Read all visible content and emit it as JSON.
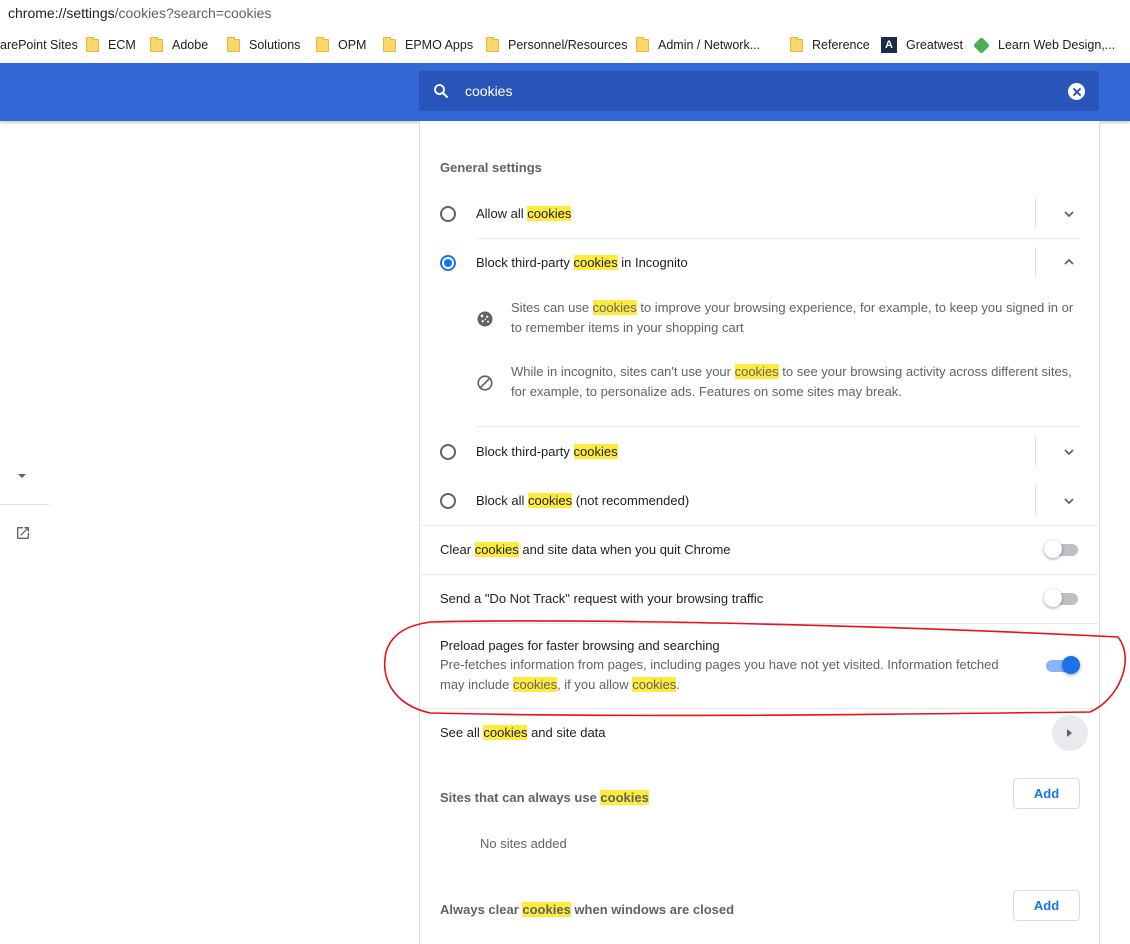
{
  "address_bar": {
    "host": "chrome://settings",
    "path": "/cookies?search=cookies"
  },
  "bookmarks": [
    {
      "label": "arePoint Sites",
      "icon": "none"
    },
    {
      "label": "ECM",
      "icon": "folder-icon"
    },
    {
      "label": "Adobe",
      "icon": "folder-icon"
    },
    {
      "label": "Solutions",
      "icon": "folder-icon"
    },
    {
      "label": "OPM",
      "icon": "folder-icon"
    },
    {
      "label": "EPMO Apps",
      "icon": "folder-icon"
    },
    {
      "label": "Personnel/Resources",
      "icon": "folder-icon"
    },
    {
      "label": "Admin / Network...",
      "icon": "folder-icon"
    },
    {
      "label": "Reference",
      "icon": "folder-icon"
    },
    {
      "label": "Greatwest",
      "icon": "greatwest-logo-icon"
    },
    {
      "label": "Learn Web Design,...",
      "icon": "learn-web-design-logo-icon"
    }
  ],
  "search": {
    "query": "cookies"
  },
  "highlight_word": "cookies",
  "general": {
    "title": "General settings",
    "allow_all": {
      "prefix": "Allow all ",
      "hl": "cookies",
      "suffix": ""
    },
    "block_incognito": {
      "prefix": "Block third-party ",
      "hl": "cookies",
      "suffix": " in Incognito",
      "detail1": {
        "prefix": "Sites can use ",
        "hl": "cookies",
        "suffix": " to improve your browsing experience, for example, to keep you signed in or to remember items in your shopping cart"
      },
      "detail2": {
        "prefix": "While in incognito, sites can't use your ",
        "hl": "cookies",
        "suffix": " to see your browsing activity across different sites, for example, to personalize ads. Features on some sites may break."
      }
    },
    "block_third_party": {
      "prefix": "Block third-party ",
      "hl": "cookies",
      "suffix": ""
    },
    "block_all": {
      "prefix": "Block all ",
      "hl": "cookies",
      "suffix": " (not recommended)"
    },
    "selected": "block_incognito"
  },
  "clear_on_quit": {
    "prefix": "Clear ",
    "hl": "cookies",
    "suffix": " and site data when you quit Chrome",
    "enabled": false
  },
  "do_not_track": {
    "label": "Send a \"Do Not Track\" request with your browsing traffic",
    "enabled": false
  },
  "preload": {
    "title": "Preload pages for faster browsing and searching",
    "desc_prefix": "Pre-fetches information from pages, including pages you have not yet visited. Information fetched may include ",
    "desc_hl1": "cookies",
    "desc_mid": ", if you allow ",
    "desc_hl2": "cookies",
    "desc_suffix": ".",
    "enabled": true
  },
  "see_all": {
    "prefix": "See all ",
    "hl": "cookies",
    "suffix": " and site data"
  },
  "always_use": {
    "prefix": "Sites that can always use ",
    "hl": "cookies",
    "add_label": "Add",
    "empty": "No sites added"
  },
  "always_clear": {
    "prefix": "Always clear ",
    "hl": "cookies",
    "suffix": " when windows are closed",
    "add_label": "Add"
  },
  "colors": {
    "header": "#3367d6",
    "searchbox": "#2a55b8",
    "accent": "#1a73e8",
    "highlight": "#ffeb3b",
    "annotation": "#e8121b"
  }
}
